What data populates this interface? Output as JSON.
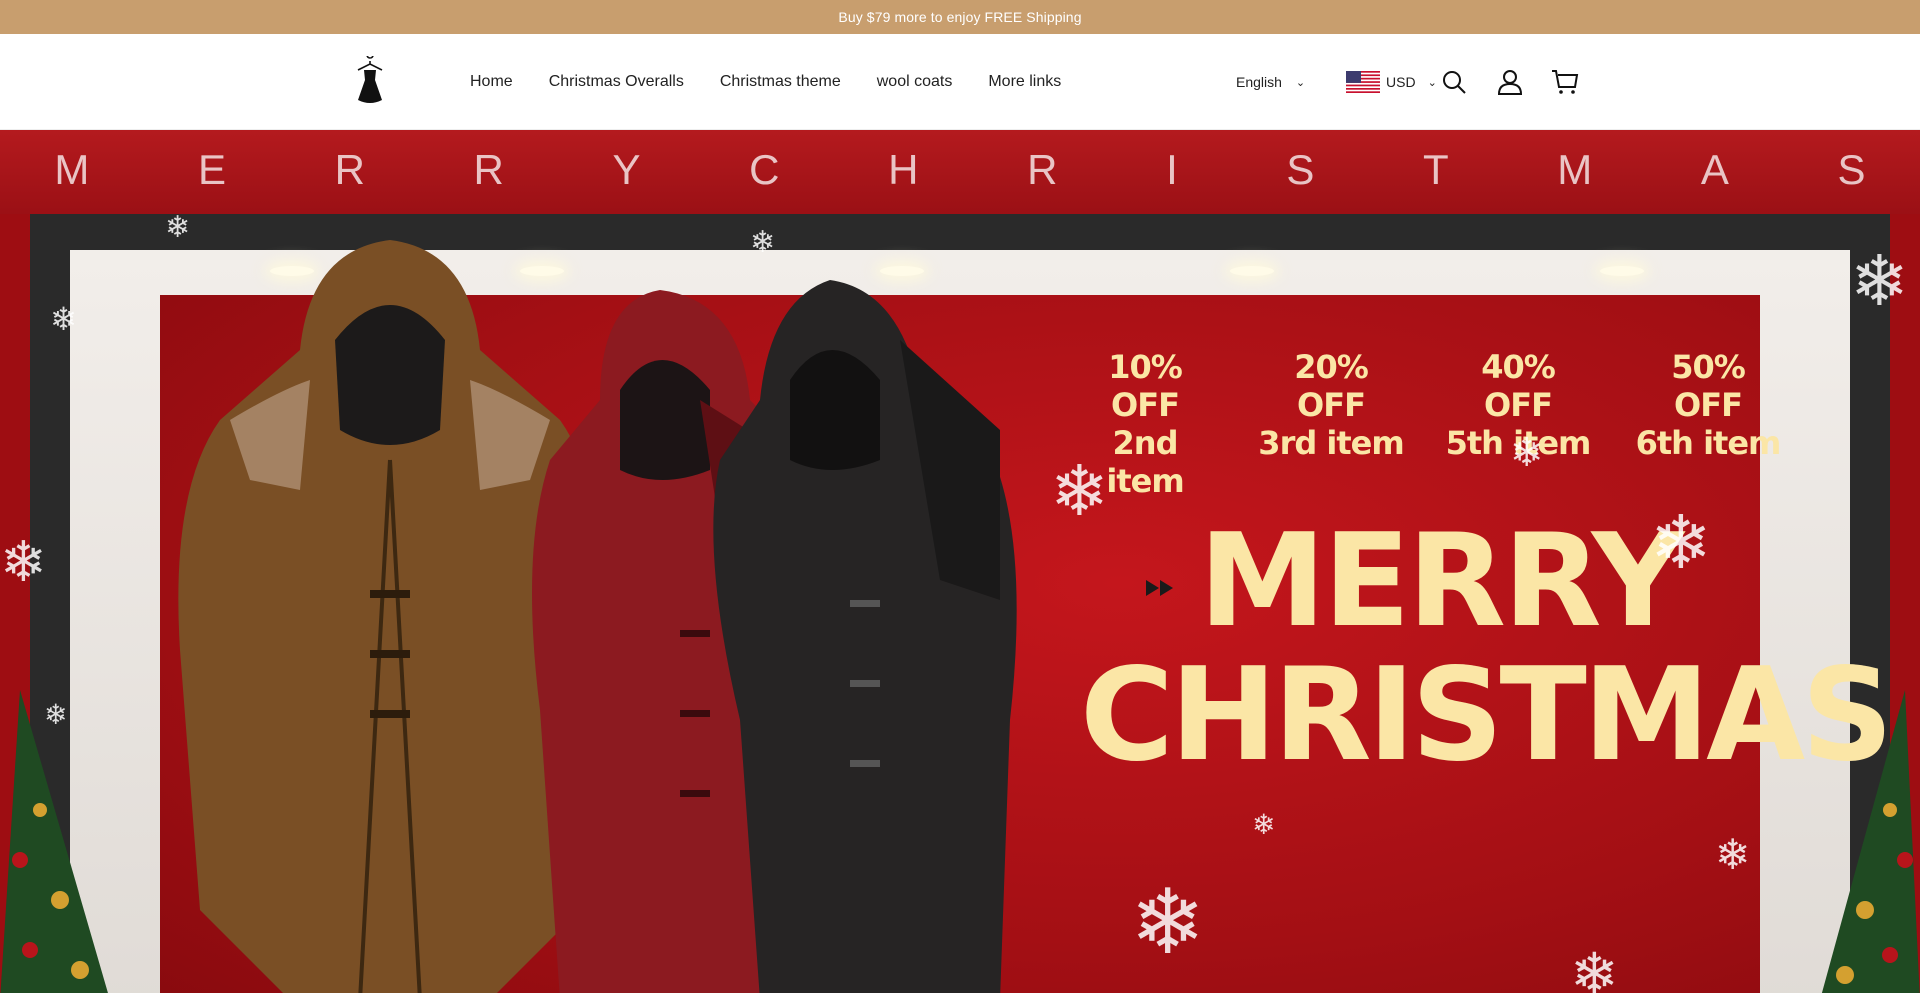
{
  "announcement": {
    "text": "Buy $79 more to enjoy FREE Shipping"
  },
  "header": {
    "logo_icon": "dress-hanger-icon",
    "nav": [
      {
        "label": "Home"
      },
      {
        "label": "Christmas Overalls"
      },
      {
        "label": "Christmas theme"
      },
      {
        "label": "wool coats"
      },
      {
        "label": "More links"
      }
    ],
    "language": {
      "label": "English",
      "icon": "chevron-down-icon"
    },
    "currency": {
      "label": "USD",
      "flag_icon": "us-flag-icon",
      "icon": "chevron-down-icon"
    },
    "icons": [
      "search-icon",
      "user-icon",
      "cart-icon"
    ]
  },
  "hero": {
    "banner_letters": [
      "M",
      "E",
      "R",
      "R",
      "Y",
      "C",
      "H",
      "R",
      "I",
      "S",
      "T",
      "M",
      "A",
      "S"
    ],
    "promos": [
      {
        "discount": "10% OFF",
        "item": "2nd item"
      },
      {
        "discount": "20% OFF",
        "item": "3rd item"
      },
      {
        "discount": "40% OFF",
        "item": "5th item"
      },
      {
        "discount": "50% OFF",
        "item": "6th item"
      }
    ],
    "headline_line1": "MERRY",
    "headline_line2": "CHRISTMAS",
    "colors": {
      "announcement_bg": "#c89e6e",
      "hero_red": "#b0121a",
      "headline": "#fbe6a6"
    }
  }
}
